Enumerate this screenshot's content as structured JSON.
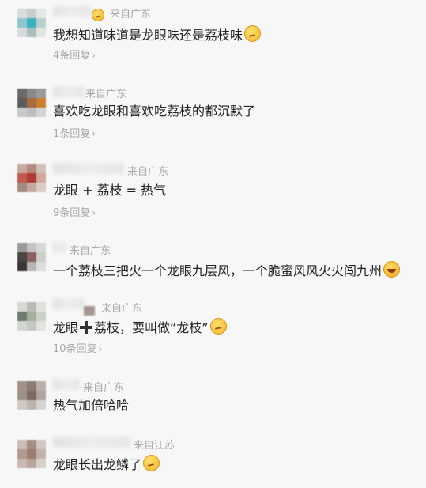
{
  "comments": [
    {
      "location": "来自广东",
      "text": "我想知道味道是龙眼味还是荔枝味",
      "emoji": "thinking-face",
      "reply": "4条回复"
    },
    {
      "location": "来自广东",
      "text": "喜欢吃龙眼和喜欢吃荔枝的都沉默了",
      "reply": "1条回复"
    },
    {
      "location": "来自广东",
      "text": "龙眼 + 荔枝 = 热气",
      "reply": "9条回复"
    },
    {
      "location": "来自广东",
      "text": "一个荔枝三把火一个龙眼九层风，一个脆蜜风风火火闯九州",
      "emoji": "laughing-crying-face"
    },
    {
      "location": "来自广东",
      "text_before": "龙眼",
      "text_after": "荔枝，要叫做“龙枝”",
      "emoji": "thinking-face",
      "reply": "10条回复"
    },
    {
      "location": "来自广东",
      "text": "热气加倍哈哈"
    },
    {
      "location": "来自江苏",
      "text": "龙眼长出龙鳞了",
      "emoji": "thinking-face"
    }
  ],
  "reply_chevron": "›"
}
